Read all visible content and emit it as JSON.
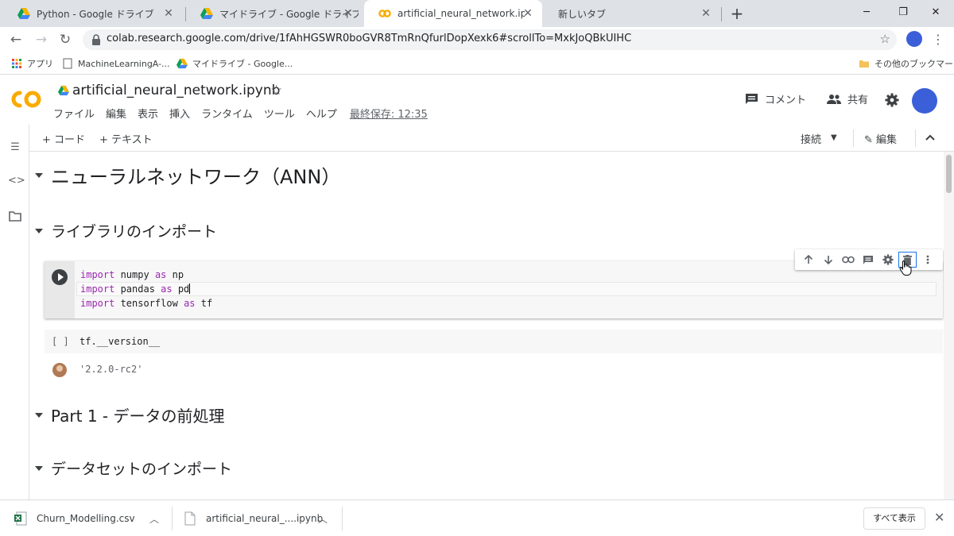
{
  "browser": {
    "tabs": [
      {
        "label": "Python - Google ドライブ",
        "active": false
      },
      {
        "label": "マイドライブ - Google ドライブ",
        "active": false
      },
      {
        "label": "artificial_neural_network.ipynb - C",
        "active": true
      },
      {
        "label": "新しいタブ",
        "active": false
      }
    ],
    "url": "colab.research.google.com/drive/1fAhHGSWR0boGVR8TmRnQfurlDopXexk6#scrollTo=MxkJoQBkUIHC",
    "bookmarks": [
      "アプリ",
      "MachineLearningA-...",
      "マイドライブ - Google...",
      "その他のブックマーク"
    ]
  },
  "colab": {
    "logo": "CO",
    "notebook_title": "artificial_neural_network.ipynb",
    "menus": [
      "ファイル",
      "編集",
      "表示",
      "挿入",
      "ランタイム",
      "ツール",
      "ヘルプ"
    ],
    "last_saved": "最終保存: 12:35",
    "comment_label": "コメント",
    "share_label": "共有"
  },
  "toolbar": {
    "add_code": "+ コード",
    "add_text": "+ テキスト",
    "connect": "接続",
    "edit": "編集"
  },
  "notebook": {
    "heading1": "ニューラルネットワーク（ANN）",
    "heading2": "ライブラリのインポート",
    "code_cell": [
      {
        "kw": "import",
        "mod": " numpy ",
        "as": "as",
        "alias": " np"
      },
      {
        "kw": "import",
        "mod": " pandas ",
        "as": "as",
        "alias": " pd"
      },
      {
        "kw": "import",
        "mod": " tensorflow ",
        "as": "as",
        "alias": " tf"
      }
    ],
    "cell2_brackets": "[ ]",
    "cell2_code": "tf.__version__",
    "cell2_output": "'2.2.0-rc2'",
    "heading3": "Part 1 - データの前処理",
    "heading4": "データセットのインポート"
  },
  "downloads": {
    "items": [
      "Churn_Modelling.csv",
      "artificial_neural_....ipynb"
    ],
    "show_all": "すべて表示"
  },
  "colors": {
    "keyword": "#9c27b0",
    "accent_orange": "#f9ab00",
    "avatar_blue": "#3b5fd8"
  }
}
